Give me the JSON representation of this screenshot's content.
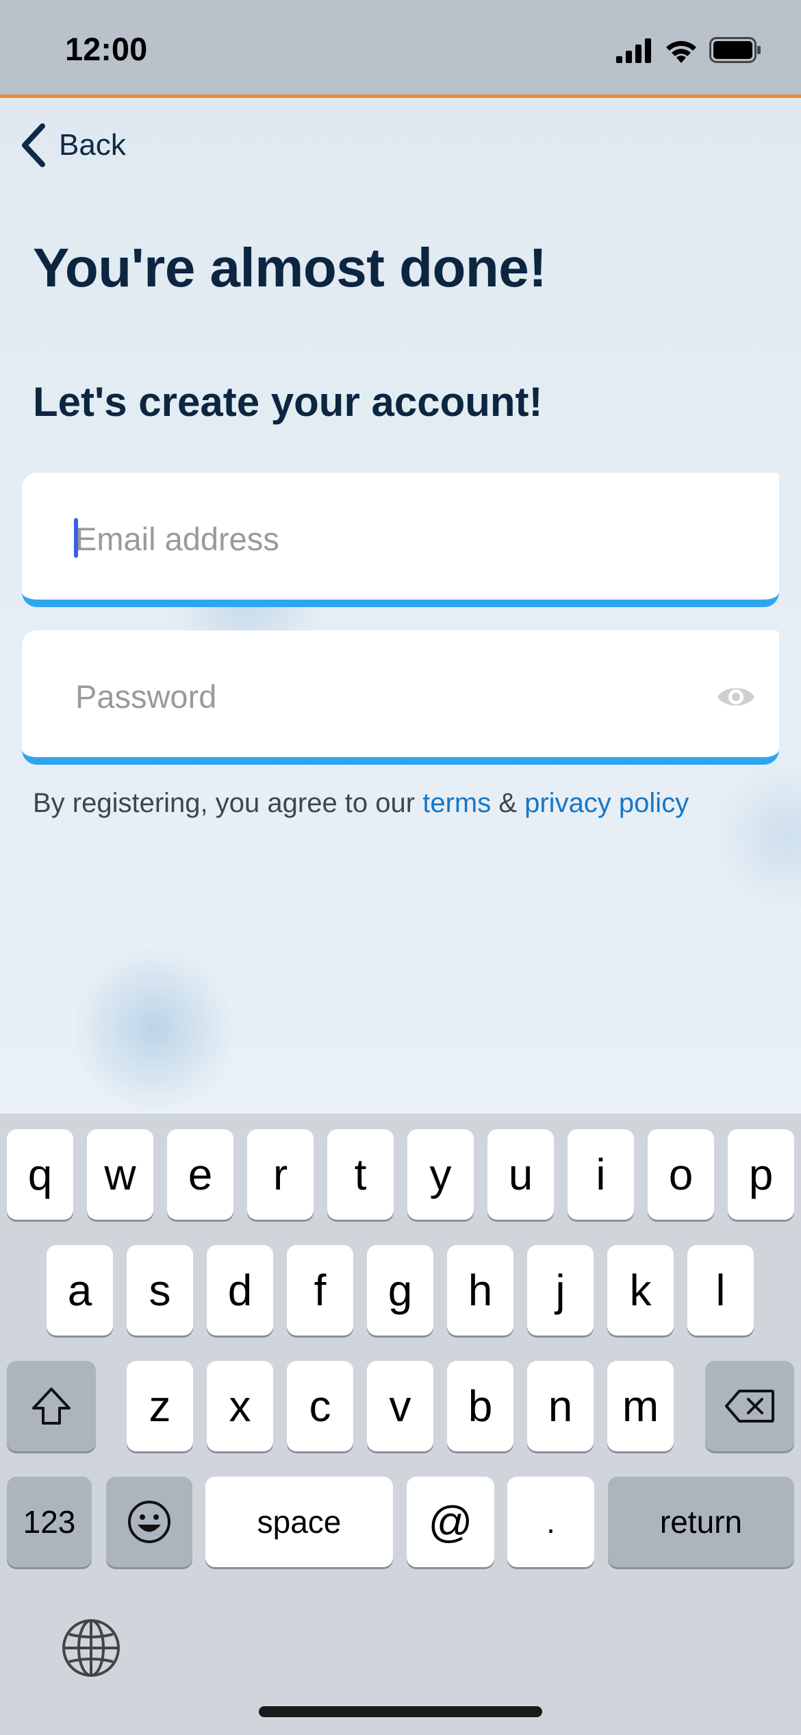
{
  "status_bar": {
    "time": "12:00"
  },
  "nav": {
    "back_label": "Back"
  },
  "header": {
    "title": "You're almost done!",
    "subtitle": "Let's create your account!"
  },
  "form": {
    "email_placeholder": "Email address",
    "password_placeholder": "Password"
  },
  "terms": {
    "prefix": "By registering, you agree to our ",
    "terms_link": "terms",
    "amp": " & ",
    "privacy_link": "privacy policy"
  },
  "colors": {
    "accent": "#2da6ef",
    "link": "#1677c6",
    "heading": "#0c2540",
    "status_border": "#f08a2a"
  },
  "keyboard": {
    "row1": [
      "q",
      "w",
      "e",
      "r",
      "t",
      "y",
      "u",
      "i",
      "o",
      "p"
    ],
    "row2": [
      "a",
      "s",
      "d",
      "f",
      "g",
      "h",
      "j",
      "k",
      "l"
    ],
    "row3": [
      "z",
      "x",
      "c",
      "v",
      "b",
      "n",
      "m"
    ],
    "numbers_label": "123",
    "space_label": "space",
    "at_label": "@",
    "dot_label": ".",
    "return_label": "return",
    "icons": [
      "shift-icon",
      "delete-icon",
      "emoji-icon",
      "globe-icon"
    ]
  }
}
